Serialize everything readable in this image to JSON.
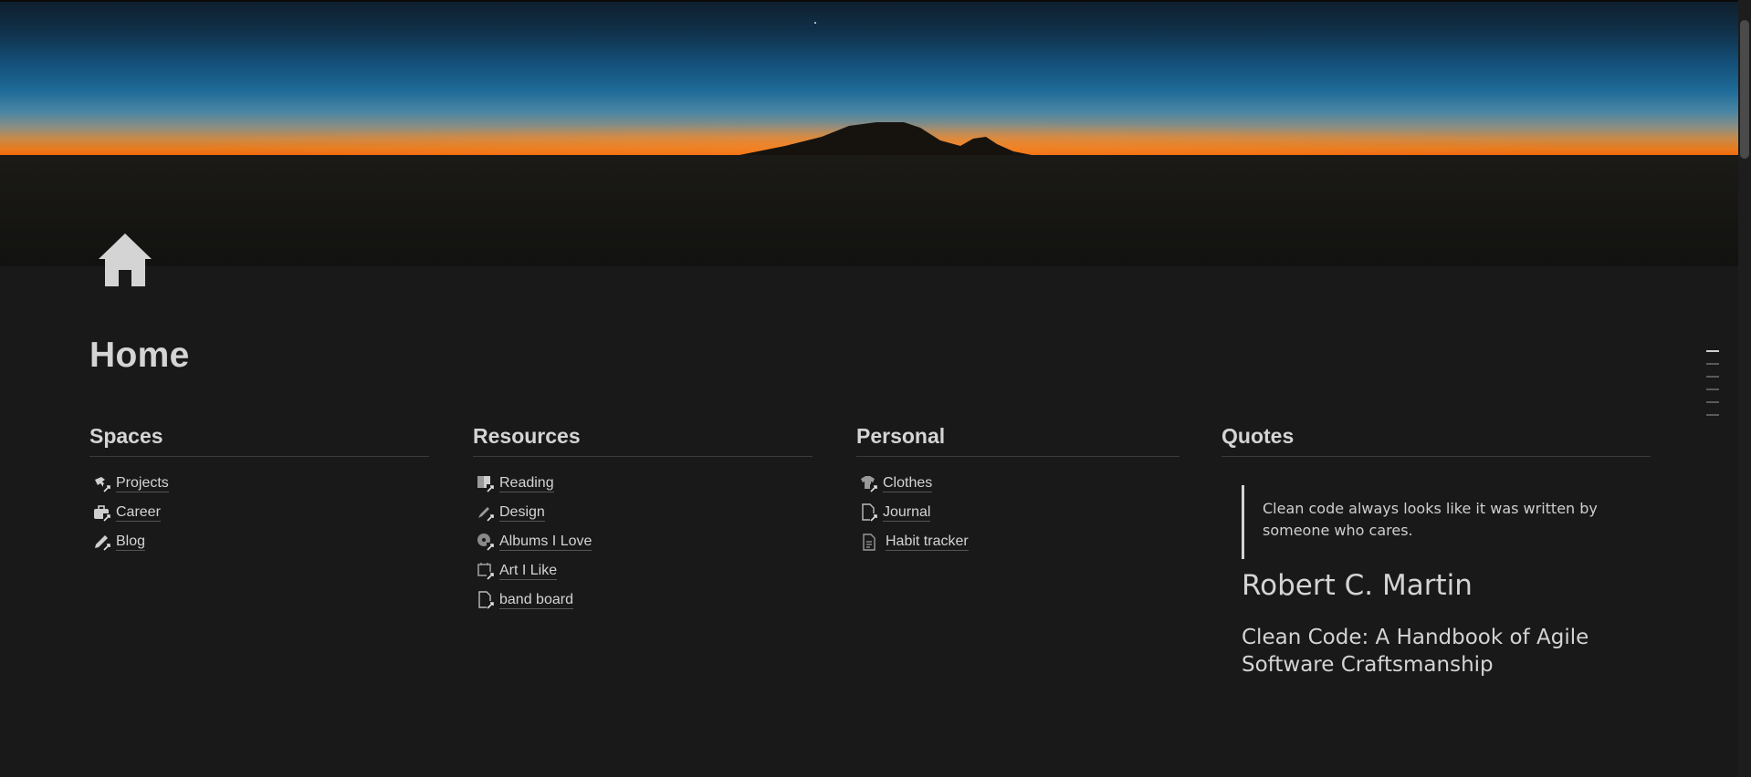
{
  "page": {
    "title": "Home",
    "icon": "house-icon"
  },
  "columns": [
    {
      "heading": "Spaces",
      "links": [
        {
          "label": "Projects",
          "icon": "hammer-link-icon"
        },
        {
          "label": "Career",
          "icon": "briefcase-link-icon"
        },
        {
          "label": "Blog",
          "icon": "pen-link-icon"
        }
      ]
    },
    {
      "heading": "Resources",
      "links": [
        {
          "label": "Reading",
          "icon": "book-link-icon"
        },
        {
          "label": "Design",
          "icon": "brush-link-icon"
        },
        {
          "label": "Albums I Love",
          "icon": "disc-link-icon"
        },
        {
          "label": "Art I Like",
          "icon": "frame-link-icon"
        },
        {
          "label": "band board",
          "icon": "document-link-icon"
        }
      ]
    },
    {
      "heading": "Personal",
      "links": [
        {
          "label": "Clothes",
          "icon": "shirt-link-icon"
        },
        {
          "label": "Journal",
          "icon": "document-link-icon"
        },
        {
          "label": "Habit tracker",
          "icon": "document-icon"
        }
      ]
    }
  ],
  "quotes": {
    "heading": "Quotes",
    "text": "Clean code always looks like it was written by someone who cares.",
    "author": "Robert C. Martin",
    "source": "Clean Code: A Handbook of Agile Software Craftsmanship"
  },
  "colors": {
    "background": "#191919",
    "text": "#d4d4d4",
    "divider": "#3a3a3a"
  }
}
